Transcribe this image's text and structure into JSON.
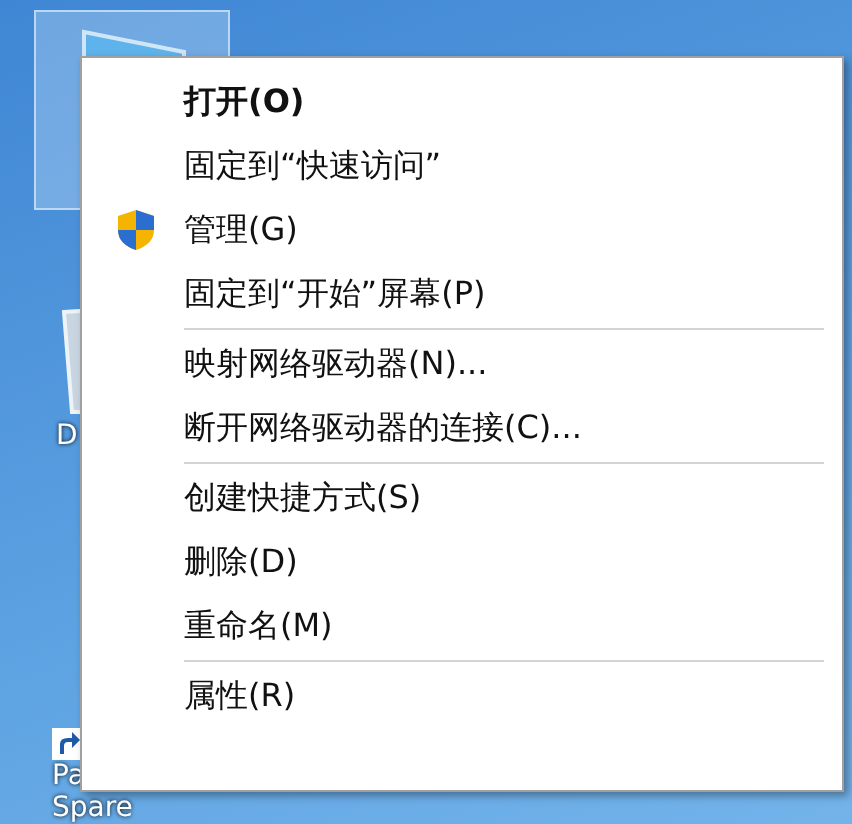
{
  "desktop": {
    "icons": [
      {
        "kind": "computer",
        "selected": true
      },
      {
        "kind": "bin",
        "label": "D",
        "selected": false
      },
      {
        "kind": "shortcut",
        "label": "Pa",
        "label_line_2": "Spare",
        "selected": false
      }
    ]
  },
  "context_menu": {
    "groups": [
      [
        {
          "label": "打开(O)",
          "default": true,
          "kind": "plain"
        },
        {
          "label": "固定到“快速访问”",
          "default": false,
          "kind": "plain"
        },
        {
          "label": "管理(G)",
          "default": false,
          "kind": "shield"
        },
        {
          "label": "固定到“开始”屏幕(P)",
          "default": false,
          "kind": "plain"
        }
      ],
      [
        {
          "label": "映射网络驱动器(N)...",
          "default": false,
          "kind": "plain"
        },
        {
          "label": "断开网络驱动器的连接(C)...",
          "default": false,
          "kind": "plain"
        }
      ],
      [
        {
          "label": "创建快捷方式(S)",
          "default": false,
          "kind": "plain"
        },
        {
          "label": "删除(D)",
          "default": false,
          "kind": "plain"
        },
        {
          "label": "重命名(M)",
          "default": false,
          "kind": "plain"
        }
      ],
      [
        {
          "label": "属性(R)",
          "default": false,
          "kind": "plain"
        }
      ]
    ]
  }
}
